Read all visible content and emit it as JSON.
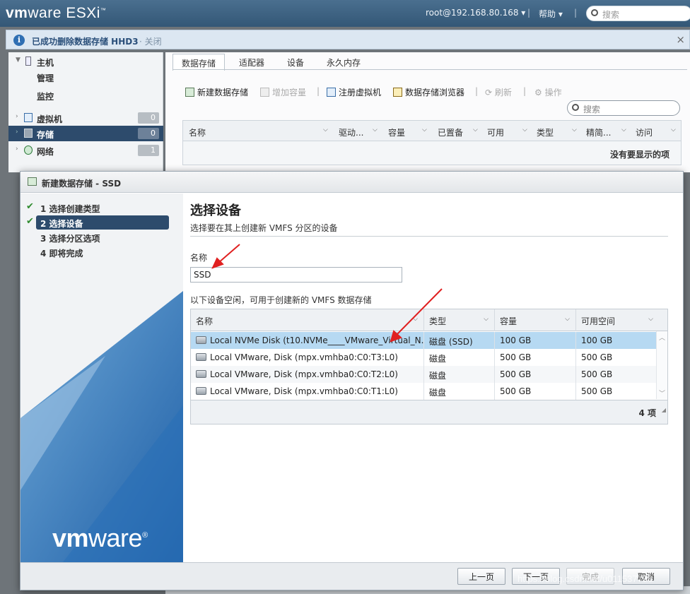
{
  "header": {
    "logo_vm": "vm",
    "logo_ware": "ware",
    "logo_product": " ESXi",
    "logo_tm": "™",
    "user": "root@192.168.80.168 ▾",
    "sep": "|",
    "help": "帮助 ▾",
    "search_placeholder": "搜索"
  },
  "notification": {
    "message": "已成功删除数据存储 HHD3",
    "close_link": "· 关闭",
    "dismiss": "×"
  },
  "navigator": {
    "host": "主机",
    "manage": "管理",
    "monitor": "监控",
    "items": [
      {
        "label": "虚拟机",
        "count": "0"
      },
      {
        "label": "存储",
        "count": "0"
      },
      {
        "label": "网络",
        "count": "1"
      }
    ]
  },
  "main": {
    "tabs": [
      "数据存储",
      "适配器",
      "设备",
      "永久内存"
    ],
    "toolbar": {
      "new_datastore": "新建数据存储",
      "increase_capacity": "增加容量",
      "register_vm": "注册虚拟机",
      "datastore_browser": "数据存储浏览器",
      "refresh": "刷新",
      "actions": "操作"
    },
    "search_placeholder": "搜索",
    "columns": [
      "名称",
      "驱动...",
      "容量",
      "已置备",
      "可用",
      "类型",
      "精简...",
      "访问"
    ],
    "empty_text": "没有要显示的项"
  },
  "dialog": {
    "title": "新建数据存储 - SSD",
    "steps": [
      {
        "label": "1 选择创建类型",
        "done": true
      },
      {
        "label": "2 选择设备",
        "done": true
      },
      {
        "label": "3 选择分区选项",
        "done": false
      },
      {
        "label": "4 即将完成",
        "done": false
      }
    ],
    "logo_vm": "vm",
    "logo_ware": "ware",
    "logo_reg": "®",
    "heading": "选择设备",
    "subheading": "选择要在其上创建新 VMFS 分区的设备",
    "name_label": "名称",
    "name_value": "SSD",
    "devices_label": "以下设备空闲，可用于创建新的 VMFS 数据存储",
    "columns": [
      "名称",
      "类型",
      "容量",
      "可用空间"
    ],
    "rows": [
      {
        "name": "Local NVMe Disk (t10.NVMe____VMware_Virtual_N...",
        "type": "磁盘 (SSD)",
        "capacity": "100 GB",
        "free": "100 GB"
      },
      {
        "name": "Local VMware, Disk (mpx.vmhba0:C0:T3:L0)",
        "type": "磁盘",
        "capacity": "500 GB",
        "free": "500 GB"
      },
      {
        "name": "Local VMware, Disk (mpx.vmhba0:C0:T2:L0)",
        "type": "磁盘",
        "capacity": "500 GB",
        "free": "500 GB"
      },
      {
        "name": "Local VMware, Disk (mpx.vmhba0:C0:T1:L0)",
        "type": "磁盘",
        "capacity": "500 GB",
        "free": "500 GB"
      }
    ],
    "item_count": "4 项",
    "buttons": {
      "back": "上一页",
      "next": "下一页",
      "finish": "完成",
      "cancel": "取消"
    }
  },
  "watermark": "https://blog.csdn.net/u011537796",
  "colors": {
    "header": "#335776",
    "selection": "#b6d9f2",
    "nav_active": "#2d4b6c",
    "wizard_blue": "#2f6fb3"
  },
  "icons": [
    "info-icon",
    "search-icon",
    "host-icon",
    "vm-icon",
    "storage-icon",
    "network-icon",
    "datastore-icon",
    "disk-icon",
    "check-icon",
    "chevron-down-icon",
    "refresh-icon",
    "gear-icon"
  ]
}
